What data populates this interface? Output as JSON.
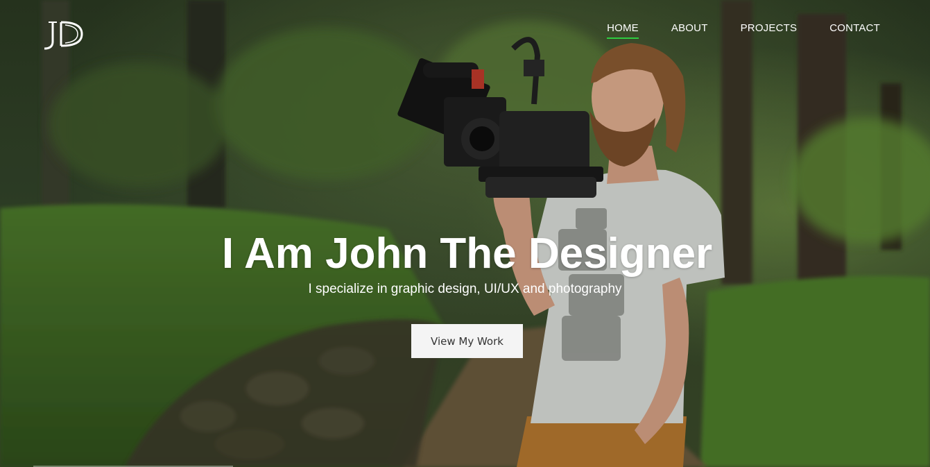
{
  "logo": {
    "text": "JD"
  },
  "nav": {
    "items": [
      {
        "label": "HOME",
        "active": true
      },
      {
        "label": "ABOUT",
        "active": false
      },
      {
        "label": "PROJECTS",
        "active": false
      },
      {
        "label": "CONTACT",
        "active": false
      }
    ],
    "active_color": "#2ecc40"
  },
  "hero": {
    "title": "I Am John The Designer",
    "subtitle": "I specialize in graphic design, UI/UX and photography",
    "cta_label": "View My Work"
  },
  "colors": {
    "text": "#ffffff",
    "button_bg": "#f4f4f4",
    "button_text": "#333333"
  }
}
